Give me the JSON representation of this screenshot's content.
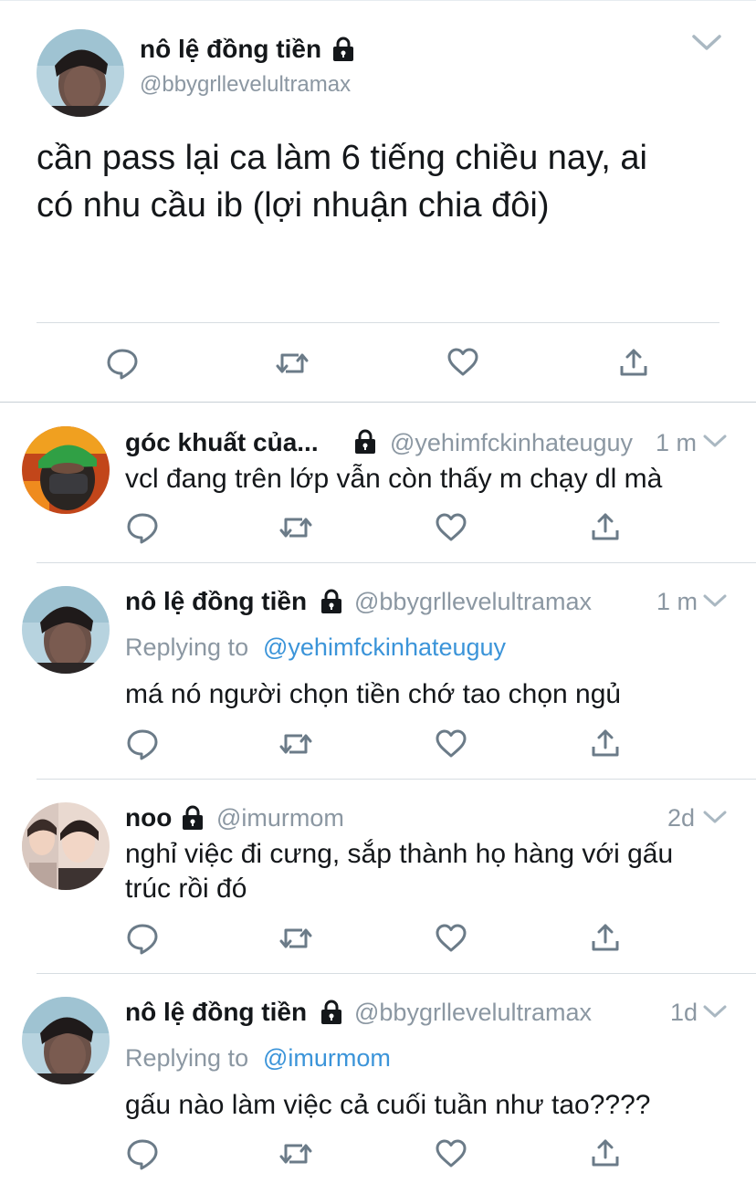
{
  "main_tweet": {
    "name": "nô lệ đồng tiền",
    "handle": "@bbygrllevelultramax",
    "text_line1": "cần pass lại ca làm 6 tiếng chiều nay, ai",
    "text_line2": "có nhu cầu ib (lợi nhuận chia đôi)"
  },
  "replies": [
    {
      "name": "góc khuất của...",
      "handle": "@yehimfckinhateuguy",
      "time": "1 m",
      "text_lines": [
        "vcl đang trên lớp vẫn còn thấy m chạy dl mà"
      ]
    },
    {
      "name": "nô lệ đồng tiền",
      "handle": "@bbygrllevelultramax",
      "time": "1 m",
      "replying_label": "Replying to",
      "replying_to": "@yehimfckinhateuguy",
      "text_lines": [
        "má nó người chọn tiền chớ tao chọn ngủ"
      ]
    },
    {
      "name": "noo",
      "handle": "@imurmom",
      "time": "2d",
      "text_lines": [
        "nghỉ việc đi cưng, sắp thành họ hàng với gấu",
        "trúc rồi đó"
      ]
    },
    {
      "name": "nô lệ đồng tiền",
      "handle": "@bbygrllevelultramax",
      "time": "1d",
      "replying_label": "Replying to",
      "replying_to": "@imurmom",
      "text_lines": [
        "gấu nào làm việc cả cuối tuần như tao????"
      ]
    }
  ],
  "icons": {
    "reply": "reply-icon",
    "retweet": "retweet-icon",
    "like": "heart-icon",
    "share": "share-icon",
    "lock": "lock-icon",
    "menu": "chevron-down-icon"
  },
  "colors": {
    "text": "#14171a",
    "secondary": "#8b97a2",
    "link": "#3b94d9",
    "icon": "#6b7b88",
    "divider": "#d7dde2"
  }
}
